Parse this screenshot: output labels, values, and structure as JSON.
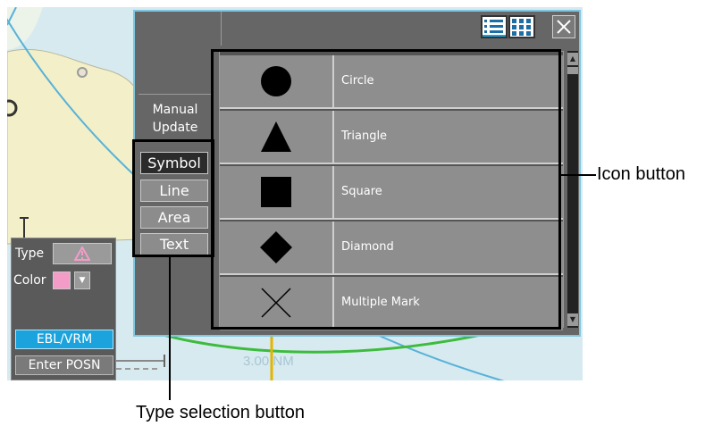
{
  "map": {
    "range_label": "3.00 NM"
  },
  "controls": {
    "type_label": "Type",
    "color_label": "Color",
    "color_value": "#f49cc8",
    "type_icon": "warning-triangle-icon",
    "ebl_vrm_label": "EBL/VRM",
    "enter_posn_label": "Enter POSN"
  },
  "dialog": {
    "manual_update_label": "Manual\nUpdate",
    "type_buttons": [
      {
        "label": "Symbol",
        "selected": true
      },
      {
        "label": "Line",
        "selected": false
      },
      {
        "label": "Area",
        "selected": false
      },
      {
        "label": "Text",
        "selected": false
      }
    ],
    "view_buttons": [
      "list-view-icon",
      "grid-view-icon"
    ],
    "symbols": [
      {
        "label": "Circle",
        "icon": "circle-icon"
      },
      {
        "label": "Triangle",
        "icon": "triangle-icon"
      },
      {
        "label": "Square",
        "icon": "square-icon"
      },
      {
        "label": "Diamond",
        "icon": "diamond-icon"
      },
      {
        "label": "Multiple Mark",
        "icon": "cross-icon"
      }
    ]
  },
  "callouts": {
    "icon_button": "Icon button",
    "type_selection_button": "Type selection button"
  },
  "colors": {
    "dialog_border": "#7fc6e0",
    "selected_button": "#2b2b2b",
    "ebl_button": "#1aa3dc"
  }
}
